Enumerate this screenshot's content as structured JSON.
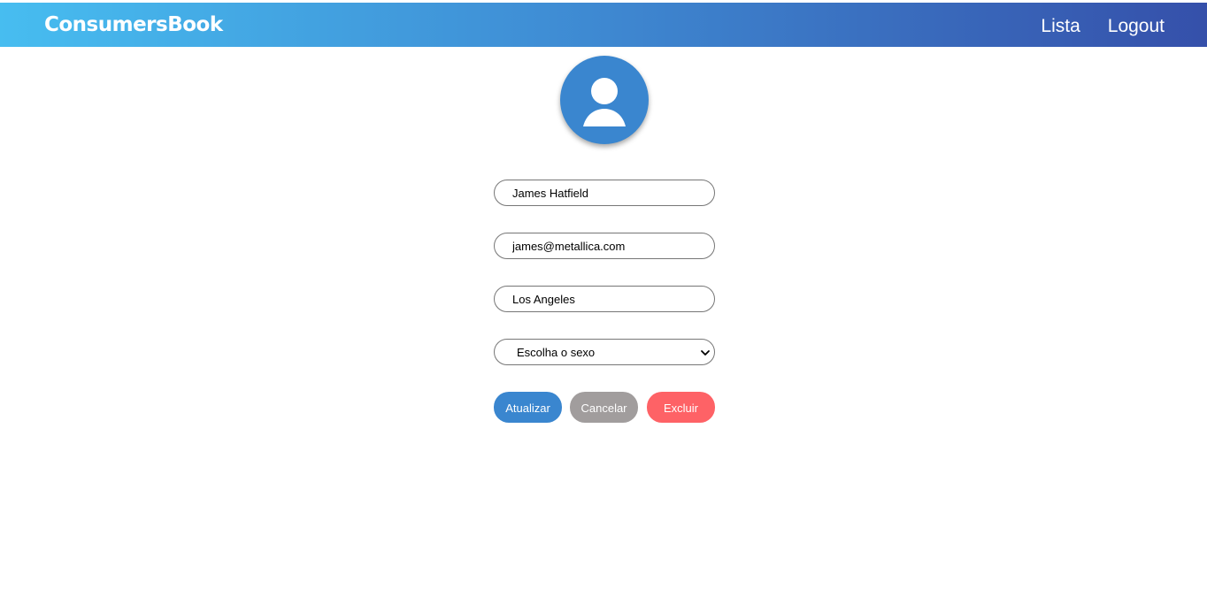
{
  "header": {
    "brand": "ConsumersBook",
    "nav": [
      {
        "label": "Lista"
      },
      {
        "label": "Logout"
      }
    ]
  },
  "profile": {
    "avatar_icon": "user-avatar-icon"
  },
  "form": {
    "name_value": "James Hatfield",
    "email_value": "james@metallica.com",
    "city_value": "Los Angeles",
    "gender_selected": "Escolha o sexo"
  },
  "actions": {
    "update_label": "Atualizar",
    "cancel_label": "Cancelar",
    "delete_label": "Excluir"
  },
  "colors": {
    "header_gradient_start": "#47bdf0",
    "header_gradient_end": "#3550aa",
    "primary": "#3a86cf",
    "neutral": "#a19d9d",
    "danger": "#fe6266"
  }
}
